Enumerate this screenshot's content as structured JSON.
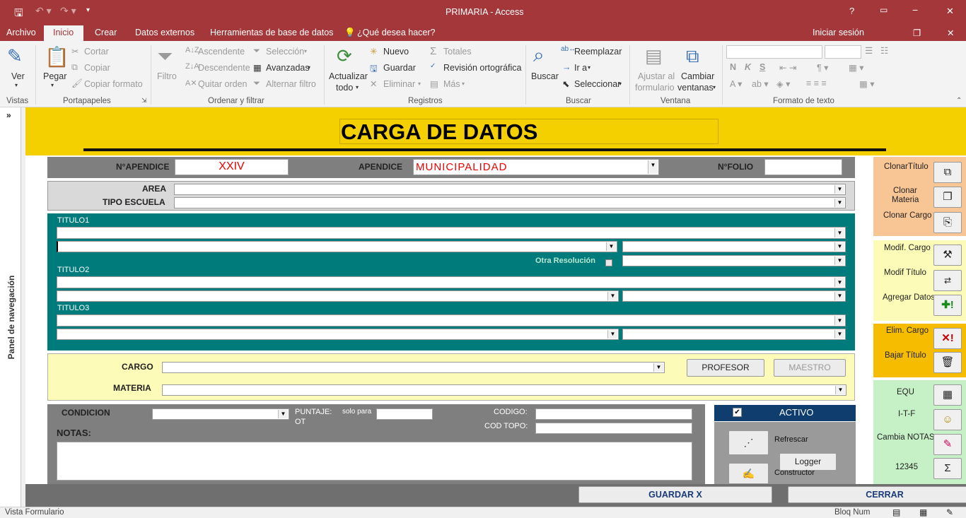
{
  "window": {
    "title": "PRIMARIA - Access",
    "help": "?",
    "minimize": "🗕",
    "restore": "🗗",
    "close": "✕"
  },
  "menu": {
    "tabs": [
      "Archivo",
      "Inicio",
      "Crear",
      "Datos externos",
      "Herramientas de base de datos"
    ],
    "tell": "¿Qué desea hacer?",
    "signin": "Iniciar sesión"
  },
  "ribbon": {
    "vistas": {
      "ver": "Ver",
      "group": "Vistas"
    },
    "portapapeles": {
      "pegar": "Pegar",
      "cortar": "Cortar",
      "copiar": "Copiar",
      "formato": "Copiar formato",
      "group": "Portapapeles"
    },
    "filtrar": {
      "filtro": "Filtro",
      "asc": "Ascendente",
      "desc": "Descendente",
      "quitar": "Quitar orden",
      "seleccion": "Selección",
      "avanzadas": "Avanzadas",
      "alternar": "Alternar filtro",
      "group": "Ordenar y filtrar"
    },
    "registros": {
      "actualizar": "Actualizar",
      "todo": "todo",
      "nuevo": "Nuevo",
      "guardar": "Guardar",
      "eliminar": "Eliminar",
      "totales": "Totales",
      "revision": "Revisión ortográfica",
      "mas": "Más",
      "group": "Registros"
    },
    "buscar": {
      "buscar": "Buscar",
      "reemplazar": "Reemplazar",
      "ira": "Ir a",
      "seleccionar": "Seleccionar",
      "group": "Buscar"
    },
    "ventana": {
      "ajustar1": "Ajustar al",
      "ajustar2": "formulario",
      "cambiar1": "Cambiar",
      "cambiar2": "ventanas",
      "group": "Ventana"
    },
    "formato": {
      "group": "Formato de texto",
      "bold": "N",
      "italic": "K",
      "underline": "S"
    }
  },
  "nav": {
    "label": "Panel de navegación"
  },
  "form": {
    "title": "CARGA DE DATOS",
    "apendice_num_label": "N°APENDICE",
    "apendice_num": "XXIV",
    "apendice_label": "APENDICE",
    "apendice": "MUNICIPALIDAD",
    "folio_label": "N°FOLIO",
    "area_label": "AREA",
    "tipo_label": "TIPO ESCUELA",
    "titulo1": "TITULO1",
    "titulo2": "TITULO2",
    "titulo3": "TITULO3",
    "otra_res": "Otra Resolución",
    "cargo_label": "CARGO",
    "materia_label": "MATERIA",
    "profesor": "PROFESOR",
    "maestro": "MAESTRO",
    "condicion_label": "CONDICION",
    "puntaje1": "PUNTAJE:",
    "puntaje2": "OT",
    "solo_para": "solo para",
    "codigo_label": "CODIGO:",
    "cod_topo_label": "COD TOPO:",
    "notas_label": "NOTAS:",
    "activo": "ACTIVO",
    "refrescar": "Refrescar",
    "logger": "Logger",
    "constructor": "Constructor",
    "guardar": "GUARDAR X",
    "cerrar": "CERRAR"
  },
  "side": {
    "clonar_titulo": "ClonarTítulo",
    "clonar_materia1": "Clonar",
    "clonar_materia2": "Materia",
    "clonar_cargo": "Clonar Cargo",
    "modif_cargo": "Modif. Cargo",
    "modif_titulo": "Modif Título",
    "agregar": "Agregar Datos",
    "elim_cargo": "Elim. Cargo",
    "bajar_titulo": "Bajar Título",
    "equ": "EQU",
    "itf": "I-T-F",
    "cambia_notas": "Cambia NOTAS",
    "num": "12345"
  },
  "status": {
    "left": "Vista Formulario",
    "right": "Bloq Num"
  },
  "colors": {
    "title_bar": "#a4373a",
    "header": "#f5d000",
    "teal": "#007b7b",
    "side_orange": "#f8c595",
    "side_yellow": "#fcfcb8",
    "side_amber": "#f6bc00",
    "side_green": "#c6f0c6",
    "activo_bar": "#0e3d6e"
  }
}
